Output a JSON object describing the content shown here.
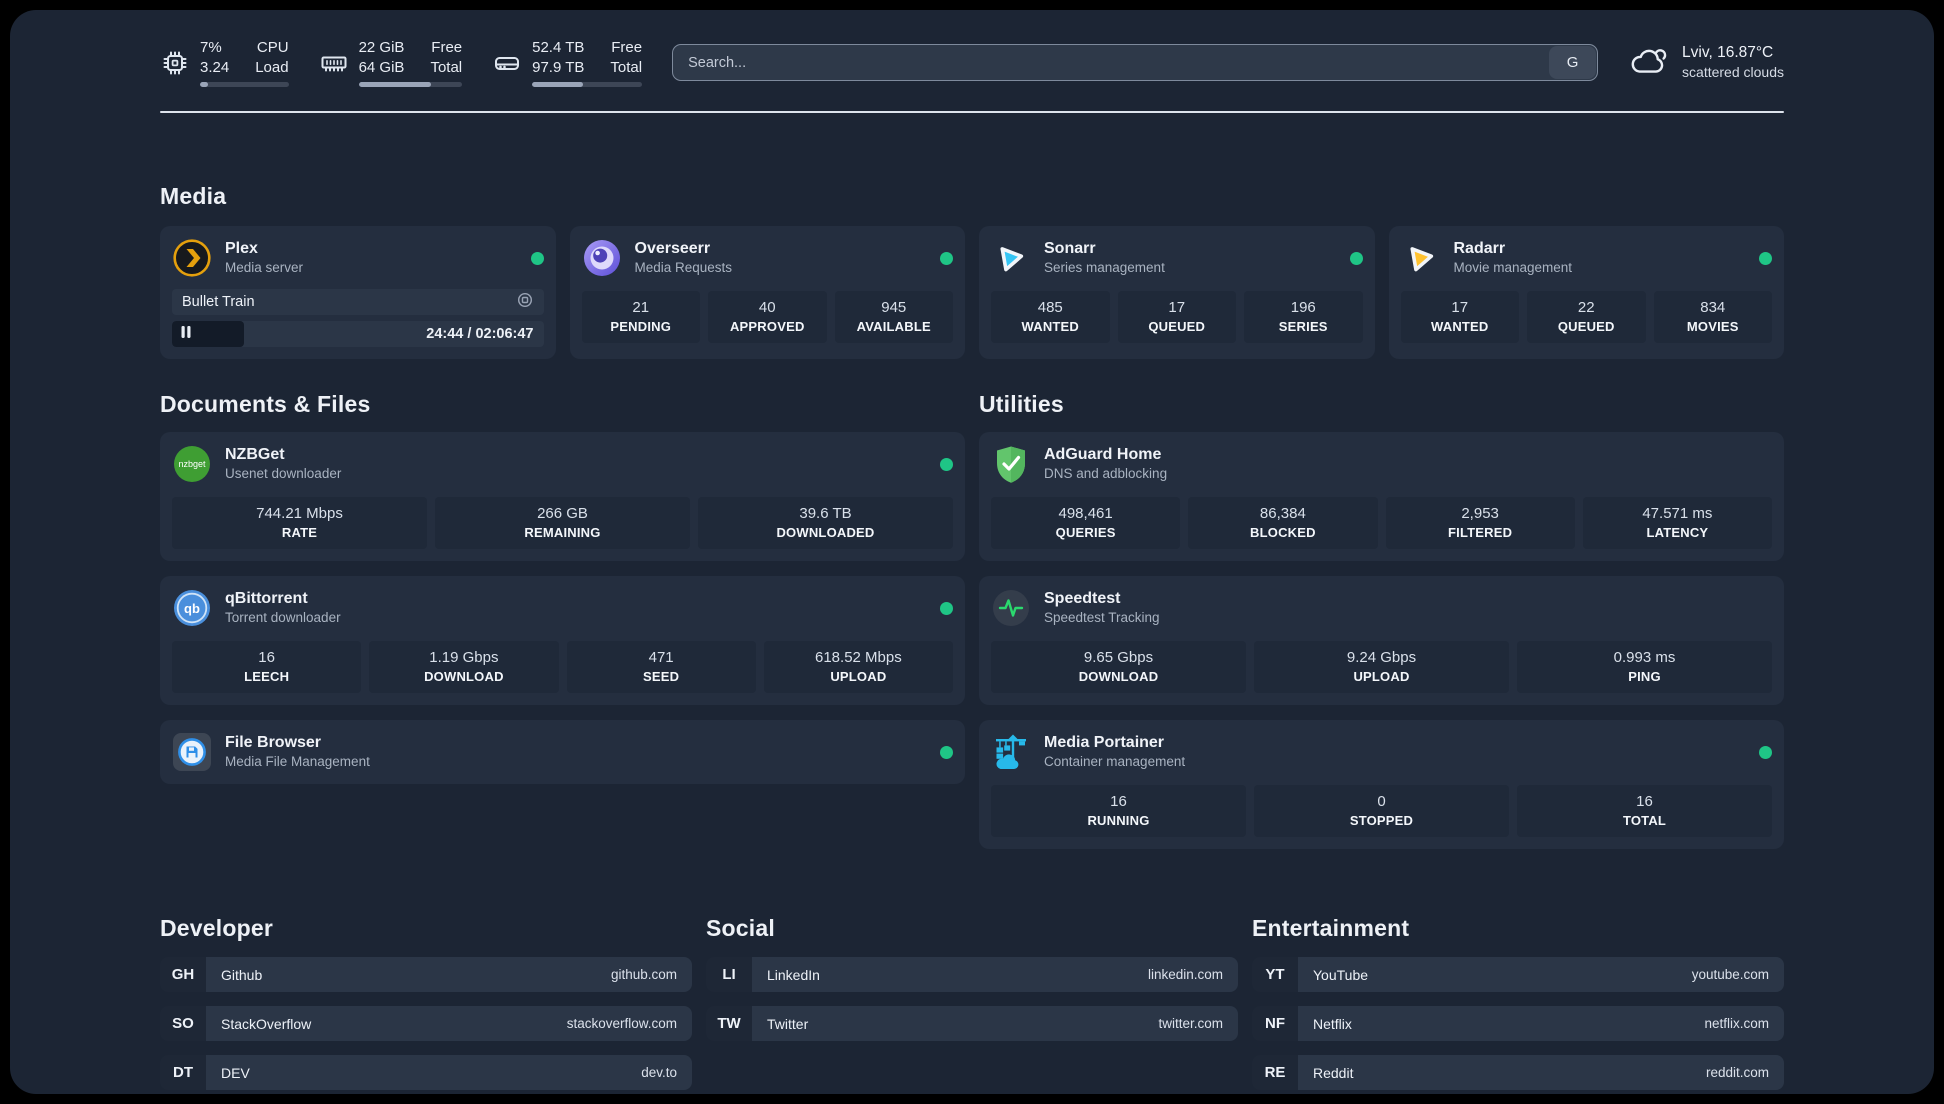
{
  "colors": {
    "status_online": "#1fc586",
    "background": "#1c2534",
    "card": "#242e3f"
  },
  "header": {
    "cpu": {
      "value_top": "7%",
      "value_bottom": "3.24",
      "label_top": "CPU",
      "label_bottom": "Load",
      "progress_pct": 9
    },
    "memory": {
      "value_top": "22 GiB",
      "value_bottom": "64 GiB",
      "label_top": "Free",
      "label_bottom": "Total",
      "progress_pct": 70
    },
    "disk": {
      "value_top": "52.4 TB",
      "value_bottom": "97.9 TB",
      "label_top": "Free",
      "label_bottom": "Total",
      "progress_pct": 46
    },
    "search": {
      "placeholder": "Search...",
      "engine_button": "G"
    },
    "weather": {
      "location_temp": "Lviv, 16.87°C",
      "condition": "scattered clouds"
    }
  },
  "sections": {
    "media": {
      "title": "Media",
      "plex": {
        "name": "Plex",
        "description": "Media server",
        "now_playing": {
          "title": "Bullet Train",
          "time_display": "24:44 / 02:06:47",
          "progress_pct": 19.5
        }
      },
      "overseerr": {
        "name": "Overseerr",
        "description": "Media Requests",
        "stats": [
          {
            "value": "21",
            "label": "PENDING"
          },
          {
            "value": "40",
            "label": "APPROVED"
          },
          {
            "value": "945",
            "label": "AVAILABLE"
          }
        ]
      },
      "sonarr": {
        "name": "Sonarr",
        "description": "Series management",
        "stats": [
          {
            "value": "485",
            "label": "WANTED"
          },
          {
            "value": "17",
            "label": "QUEUED"
          },
          {
            "value": "196",
            "label": "SERIES"
          }
        ]
      },
      "radarr": {
        "name": "Radarr",
        "description": "Movie management",
        "stats": [
          {
            "value": "17",
            "label": "WANTED"
          },
          {
            "value": "22",
            "label": "QUEUED"
          },
          {
            "value": "834",
            "label": "MOVIES"
          }
        ]
      }
    },
    "documents": {
      "title": "Documents & Files",
      "nzbget": {
        "name": "NZBGet",
        "description": "Usenet downloader",
        "stats": [
          {
            "value": "744.21 Mbps",
            "label": "RATE"
          },
          {
            "value": "266 GB",
            "label": "REMAINING"
          },
          {
            "value": "39.6 TB",
            "label": "DOWNLOADED"
          }
        ]
      },
      "qbittorrent": {
        "name": "qBittorrent",
        "description": "Torrent downloader",
        "stats": [
          {
            "value": "16",
            "label": "LEECH"
          },
          {
            "value": "1.19 Gbps",
            "label": "DOWNLOAD"
          },
          {
            "value": "471",
            "label": "SEED"
          },
          {
            "value": "618.52 Mbps",
            "label": "UPLOAD"
          }
        ]
      },
      "filebrowser": {
        "name": "File Browser",
        "description": "Media File Management"
      }
    },
    "utilities": {
      "title": "Utilities",
      "adguard": {
        "name": "AdGuard Home",
        "description": "DNS and adblocking",
        "stats": [
          {
            "value": "498,461",
            "label": "QUERIES"
          },
          {
            "value": "86,384",
            "label": "BLOCKED"
          },
          {
            "value": "2,953",
            "label": "FILTERED"
          },
          {
            "value": "47.571 ms",
            "label": "LATENCY"
          }
        ]
      },
      "speedtest": {
        "name": "Speedtest",
        "description": "Speedtest Tracking",
        "stats": [
          {
            "value": "9.65 Gbps",
            "label": "DOWNLOAD"
          },
          {
            "value": "9.24 Gbps",
            "label": "UPLOAD"
          },
          {
            "value": "0.993 ms",
            "label": "PING"
          }
        ]
      },
      "portainer": {
        "name": "Media Portainer",
        "description": "Container management",
        "stats": [
          {
            "value": "16",
            "label": "RUNNING"
          },
          {
            "value": "0",
            "label": "STOPPED"
          },
          {
            "value": "16",
            "label": "TOTAL"
          }
        ]
      }
    },
    "bookmarks": [
      {
        "title": "Developer",
        "items": [
          {
            "abbr": "GH",
            "name": "Github",
            "url": "github.com"
          },
          {
            "abbr": "SO",
            "name": "StackOverflow",
            "url": "stackoverflow.com"
          },
          {
            "abbr": "DT",
            "name": "DEV",
            "url": "dev.to"
          }
        ]
      },
      {
        "title": "Social",
        "items": [
          {
            "abbr": "LI",
            "name": "LinkedIn",
            "url": "linkedin.com"
          },
          {
            "abbr": "TW",
            "name": "Twitter",
            "url": "twitter.com"
          }
        ]
      },
      {
        "title": "Entertainment",
        "items": [
          {
            "abbr": "YT",
            "name": "YouTube",
            "url": "youtube.com"
          },
          {
            "abbr": "NF",
            "name": "Netflix",
            "url": "netflix.com"
          },
          {
            "abbr": "RE",
            "name": "Reddit",
            "url": "reddit.com"
          }
        ]
      }
    ]
  }
}
